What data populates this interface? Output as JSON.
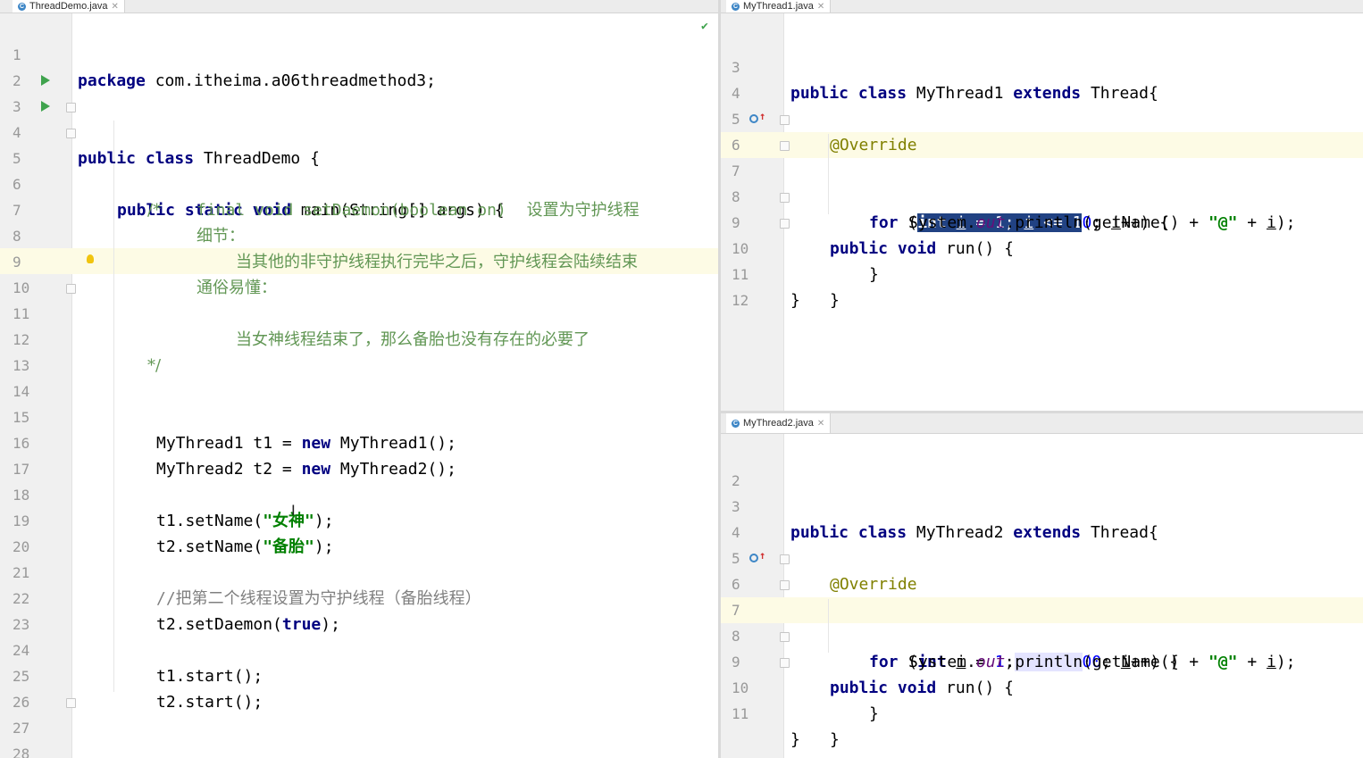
{
  "left_pane": {
    "tab_label": "ThreadDemo.java",
    "lines": [
      {
        "n": "1",
        "t": "package com.itheima.a06threadmethod3;"
      },
      {
        "n": "2",
        "t": ""
      },
      {
        "n": "3",
        "t": "public class ThreadDemo {"
      },
      {
        "n": "4",
        "t": "    public static void main(String[] args) {"
      },
      {
        "n": "5",
        "t": "       /*"
      },
      {
        "n": "6",
        "t": "            final void setDaemon(boolean on)    设置为守护线程"
      },
      {
        "n": "7",
        "t": "            细节："
      },
      {
        "n": "8",
        "t": "                当其他的非守护线程执行完毕之后，守护线程会陆续结束"
      },
      {
        "n": "9",
        "t": "            通俗易懂："
      },
      {
        "n": "10",
        "t": "                当女神线程结束了，那么备胎也没有存在的必要了"
      },
      {
        "n": "11",
        "t": "       */"
      },
      {
        "n": "12",
        "t": ""
      },
      {
        "n": "13",
        "t": ""
      },
      {
        "n": "14",
        "t": ""
      },
      {
        "n": "15",
        "t": "        MyThread1 t1 = new MyThread1();"
      },
      {
        "n": "16",
        "t": "        MyThread2 t2 = new MyThread2();"
      },
      {
        "n": "17",
        "t": ""
      },
      {
        "n": "18",
        "t": "        t1.setName(\"女神\");"
      },
      {
        "n": "19",
        "t": "        t2.setName(\"备胎\");"
      },
      {
        "n": "20",
        "t": ""
      },
      {
        "n": "21",
        "t": "        //把第二个线程设置为守护线程（备胎线程）"
      },
      {
        "n": "22",
        "t": "        t2.setDaemon(true);"
      },
      {
        "n": "23",
        "t": ""
      },
      {
        "n": "24",
        "t": "        t1.start();"
      },
      {
        "n": "25",
        "t": "        t2.start();"
      },
      {
        "n": "26",
        "t": ""
      },
      {
        "n": "27",
        "t": "    }"
      },
      {
        "n": "28",
        "t": "}"
      },
      {
        "n": "29",
        "t": ""
      }
    ]
  },
  "right_top_pane": {
    "tab_label": "MyThread1.java",
    "lines": [
      {
        "n": "3",
        "t": "public class MyThread1 extends Thread{"
      },
      {
        "n": "4",
        "t": ""
      },
      {
        "n": "5",
        "t": "    @Override"
      },
      {
        "n": "6",
        "t": "    public void run() {"
      },
      {
        "n": "7",
        "t": "        for (int i = 1; i <= 10; i++) {"
      },
      {
        "n": "8",
        "t": "            System.out.println(getName() + \"@\" + i);"
      },
      {
        "n": "9",
        "t": "        }"
      },
      {
        "n": "10",
        "t": "    }"
      },
      {
        "n": "11",
        "t": "}"
      },
      {
        "n": "12",
        "t": ""
      }
    ]
  },
  "right_bottom_pane": {
    "tab_label": "MyThread2.java",
    "lines": [
      {
        "n": "2",
        "t": ""
      },
      {
        "n": "3",
        "t": "public class MyThread2 extends Thread{"
      },
      {
        "n": "4",
        "t": ""
      },
      {
        "n": "5",
        "t": "    @Override"
      },
      {
        "n": "6",
        "t": "    public void run() {"
      },
      {
        "n": "7",
        "t": "        for (int i = 1; i <= 100; i++) {"
      },
      {
        "n": "8",
        "t": "            System.out.println(getName() + \"@\" + i);"
      },
      {
        "n": "9",
        "t": "        }"
      },
      {
        "n": "10",
        "t": "    }"
      },
      {
        "n": "11",
        "t": "}"
      }
    ]
  },
  "colors": {
    "keyword": "#000080",
    "string": "#008000",
    "number": "#0000ff",
    "annotation": "#808000",
    "javadoc": "#629755",
    "selection": "#214283",
    "current_line": "#fdfbe5"
  }
}
